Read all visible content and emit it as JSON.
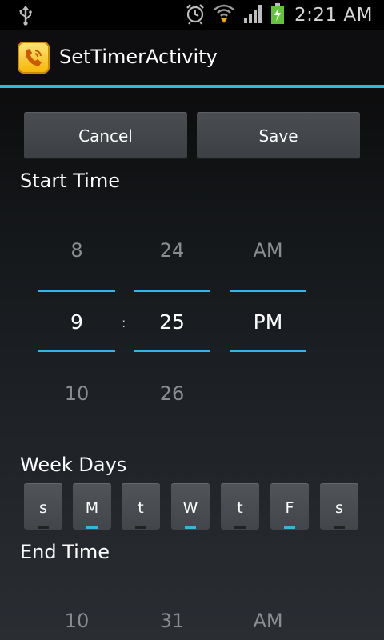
{
  "status_bar": {
    "time": "2:21 AM",
    "icons": [
      "usb-icon",
      "alarm-icon",
      "wifi-icon",
      "signal-icon",
      "battery-charging-icon"
    ]
  },
  "title_bar": {
    "title": "SetTimerActivity",
    "icon": "phone-app-icon"
  },
  "buttons": {
    "cancel": "Cancel",
    "save": "Save"
  },
  "start_time": {
    "label": "Start Time",
    "hour": {
      "prev": "8",
      "current": "9",
      "next": "10"
    },
    "separator": ":",
    "minute": {
      "prev": "24",
      "current": "25",
      "next": "26"
    },
    "ampm": {
      "prev": "AM",
      "current": "PM"
    }
  },
  "week_days": {
    "label": "Week Days",
    "days": [
      {
        "letter": "s",
        "selected": false
      },
      {
        "letter": "M",
        "selected": true
      },
      {
        "letter": "t",
        "selected": false
      },
      {
        "letter": "W",
        "selected": true
      },
      {
        "letter": "t",
        "selected": false
      },
      {
        "letter": "F",
        "selected": true
      },
      {
        "letter": "s",
        "selected": false
      }
    ]
  },
  "end_time": {
    "label": "End Time",
    "hour": {
      "prev": "10"
    },
    "minute": {
      "prev": "31"
    },
    "ampm": {
      "prev": "AM"
    }
  },
  "colors": {
    "accent": "#33b5e5",
    "background": "#15181b"
  }
}
